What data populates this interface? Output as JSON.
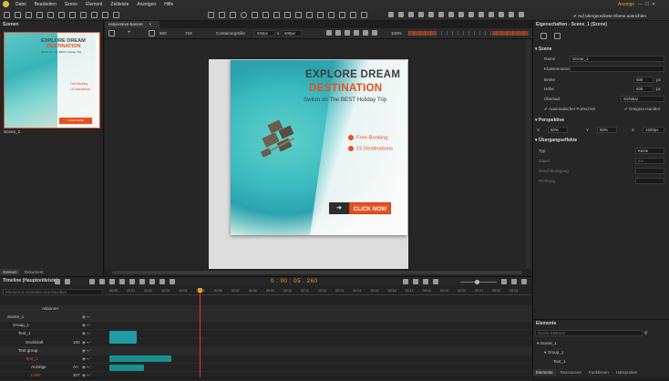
{
  "menu": {
    "items": [
      "Datei",
      "Bearbeiten",
      "Szene",
      "Element",
      "Zeitleiste",
      "Anzeigen",
      "Hilfe"
    ],
    "account": "Anzeige"
  },
  "doc_tab": {
    "name": "responsive-banner",
    "close": "×"
  },
  "scenes_panel": {
    "title": "Szenen",
    "scene_name": "Scene_1",
    "tabs": [
      "Szenen",
      "Dokument"
    ]
  },
  "canvas_toolbar": {
    "w": "500",
    "h": "728",
    "container_label": "Containergröße",
    "cw": "634px",
    "ch": "600px",
    "zoom": "100%"
  },
  "banner": {
    "title1": "EXPLORE DREAM",
    "title2": "DESTINATION",
    "subtitle": "Switch on The BEST Holiday Trip",
    "feature1": "Free Booking",
    "feature2": "15 Destinations",
    "cta": "CLICK NOW",
    "arrow": "➔"
  },
  "colors": {
    "accent": "#e8501e",
    "bg": "#1e1e1e",
    "panel": "#2b2b2b"
  },
  "timeline": {
    "title": "Timeline (Hauptzeitleiste)",
    "search_placeholder": "Element & Animation durchsuchen",
    "time": "0 : 00 : 05 . 260",
    "ticks": [
      "00:00",
      "00:01",
      "00:02",
      "00:03",
      "00:04",
      "00:05",
      "00:06",
      "00:07",
      "00:08",
      "00:09",
      "00:10",
      "00:11",
      "00:12",
      "00:13",
      "00:14",
      "00:15",
      "00:16",
      "00:17",
      "00:18",
      "00:19",
      "00:20",
      "00:21",
      "00:22",
      "00:23"
    ],
    "actions_label": "Aktionen",
    "rows": [
      {
        "label": "Scene_1",
        "value": ""
      },
      {
        "label": "Group_1",
        "value": ""
      },
      {
        "label": "Text_1",
        "value": ""
      },
      {
        "label": "Deckkraft",
        "value": "100"
      },
      {
        "label": "Text group",
        "value": ""
      },
      {
        "label": "Text_1",
        "value": ""
      },
      {
        "label": "Anzeige",
        "value": "An"
      },
      {
        "label": "Links",
        "value": "327"
      }
    ]
  },
  "properties": {
    "title": "Eigenschaften - Scene_1 (Szene)",
    "checkbox": "Auf übergeordnete Ebene ausrichten",
    "section_scene": "Szene",
    "name_label": "Name",
    "name_value": "Scene_1",
    "class_label": "Klassenname",
    "class_value": "",
    "width_label": "Breite",
    "width_value": "500",
    "width_unit": "px",
    "height_label": "Höhe",
    "height_value": "500",
    "height_unit": "px",
    "overflow_label": "Überlauf",
    "overflow_value": "Sichtbar",
    "auto_advance": "Automatischer Fortschritt",
    "event_handler": "Ereignis-Handler",
    "section_persp": "Perspektive",
    "px": "X",
    "pxv": "50%",
    "py": "Y",
    "pyv": "50%",
    "pz": "Z",
    "pzv": "1200px",
    "section_trans": "Übergangseffekte",
    "typ_label": "Typ",
    "typ_value": "Keine",
    "dauer_label": "Dauer",
    "dauer_value": "ms",
    "besch_label": "Beschleunigung",
    "richt_label": "Richtung"
  },
  "elements_panel": {
    "title": "Elemente",
    "search_placeholder": "Suche Element",
    "items": [
      "Scene_1",
      "Group_1",
      "Text_1"
    ],
    "tabs": [
      "Elemente",
      "Ressourcen",
      "Funktionen",
      "Haltepunkte"
    ]
  }
}
